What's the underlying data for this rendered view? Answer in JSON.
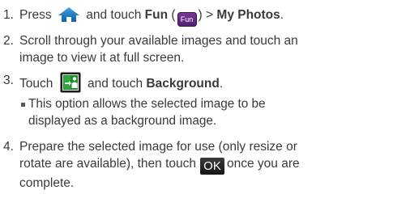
{
  "steps": [
    {
      "num": "1.",
      "text_a": "Press",
      "text_b": "and touch",
      "fun_label": "Fun",
      "paren_open": "(",
      "fun_icon_text": "Fun",
      "paren_close": ")",
      "gt": ">",
      "photos_label": "My Photos",
      "period": "."
    },
    {
      "num": "2.",
      "line1": "Scroll through your available images and touch an",
      "line2": "image to view it at full screen."
    },
    {
      "num": "3.",
      "text_a": "Touch",
      "text_b": "and touch",
      "bg_label": "Background",
      "period": ".",
      "bullet_line1": "This option allows the selected image to be",
      "bullet_line2": "displayed as a background image."
    },
    {
      "num": "4.",
      "line1": "Prepare the selected image for use (only resize or",
      "line2": "rotate are available), then touch",
      "ok_label": "OK",
      "line2_end": "once you are",
      "line3": "complete."
    }
  ],
  "icons": {
    "home": "home-icon",
    "fun": "fun-icon",
    "background": "set-background-icon"
  },
  "colors": {
    "home_icon": "#1a7fc9",
    "fun_icon": "#5b2780",
    "bg_icon_frame": "#2e9a3a",
    "ok_button": "#222222",
    "text": "#3a3a3a"
  }
}
